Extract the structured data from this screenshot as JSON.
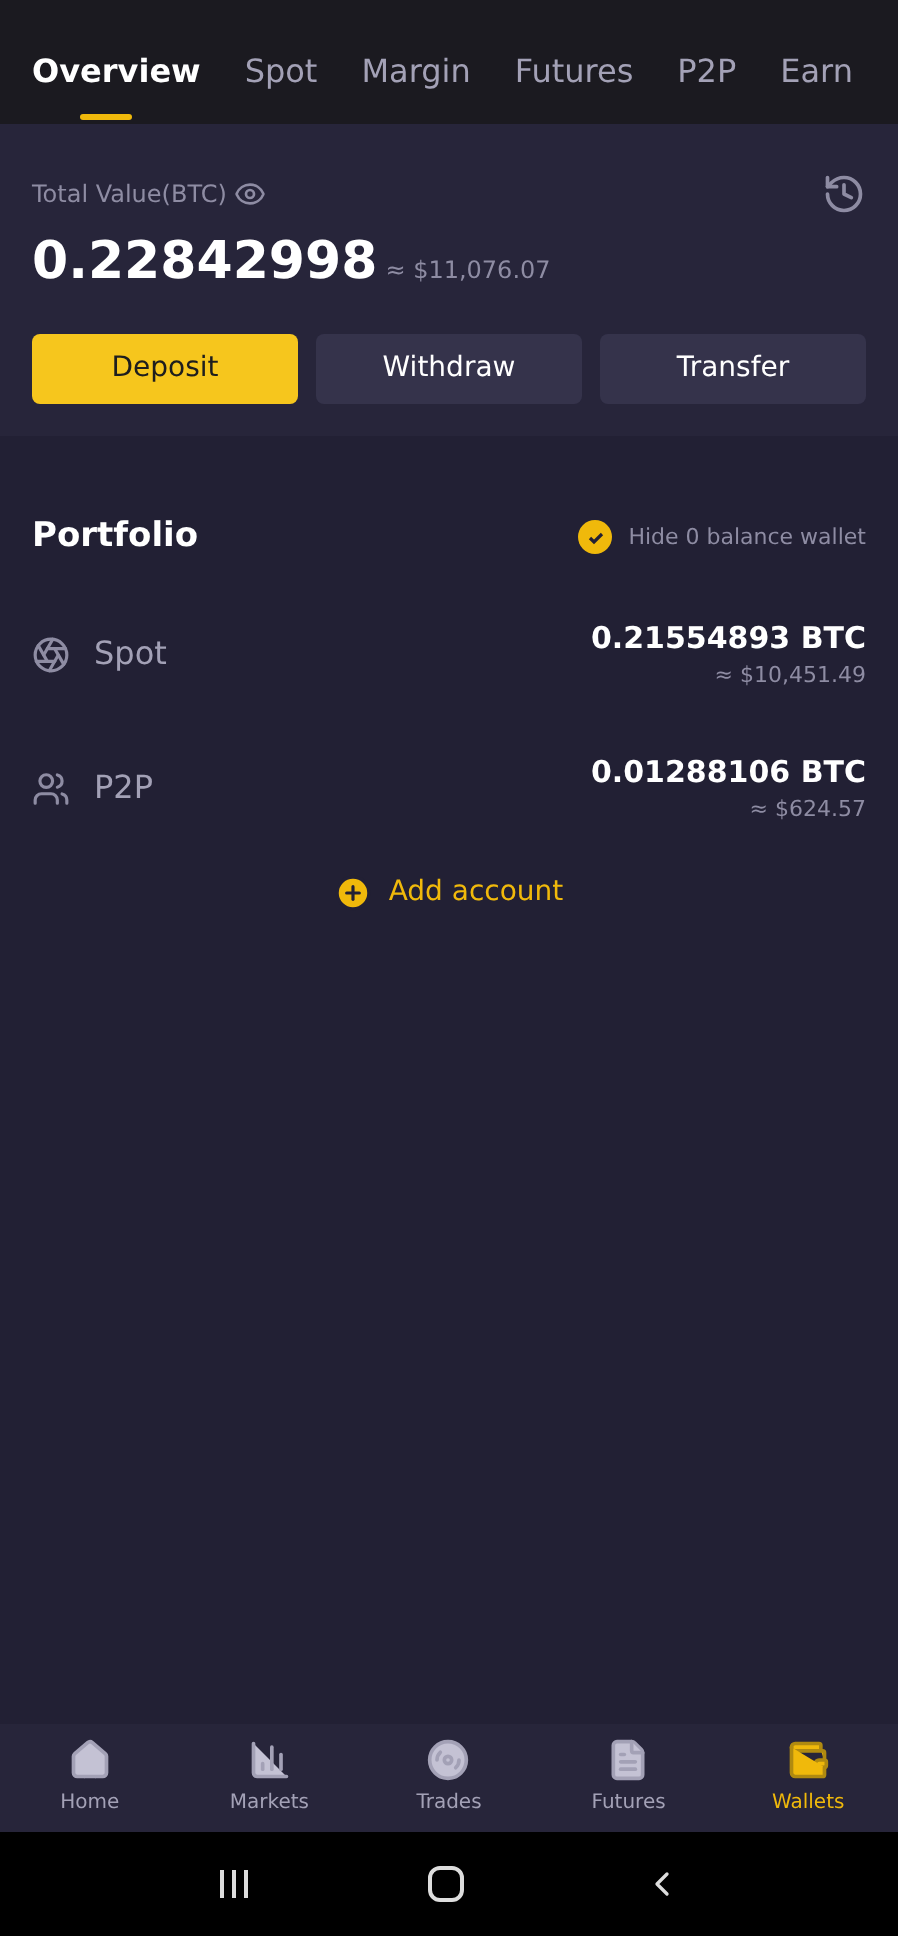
{
  "tabs": [
    {
      "label": "Overview",
      "selected": true
    },
    {
      "label": "Spot",
      "selected": false
    },
    {
      "label": "Margin",
      "selected": false
    },
    {
      "label": "Futures",
      "selected": false
    },
    {
      "label": "P2P",
      "selected": false
    },
    {
      "label": "Earn",
      "selected": false
    }
  ],
  "total": {
    "label": "Total Value(BTC)",
    "value": "0.22842998",
    "fiat": "≈ $11,076.07"
  },
  "actions": [
    {
      "label": "Deposit",
      "kind": "primary"
    },
    {
      "label": "Withdraw",
      "kind": "secondary"
    },
    {
      "label": "Transfer",
      "kind": "secondary"
    }
  ],
  "portfolio": {
    "title": "Portfolio",
    "hide_zero": {
      "label": "Hide 0 balance wallet",
      "checked": true
    },
    "accounts": [
      {
        "name": "Spot",
        "kind": "spot",
        "amount": "0.21554893 BTC",
        "fiat": "≈ $10,451.49"
      },
      {
        "name": "P2P",
        "kind": "p2p",
        "amount": "0.01288106 BTC",
        "fiat": "≈ $624.57"
      }
    ],
    "add_account": "Add account"
  },
  "bottom_nav": [
    {
      "label": "Home",
      "kind": "home",
      "selected": false
    },
    {
      "label": "Markets",
      "kind": "markets",
      "selected": false
    },
    {
      "label": "Trades",
      "kind": "trades",
      "selected": false
    },
    {
      "label": "Futures",
      "kind": "futures",
      "selected": false
    },
    {
      "label": "Wallets",
      "kind": "wallets",
      "selected": true
    }
  ]
}
